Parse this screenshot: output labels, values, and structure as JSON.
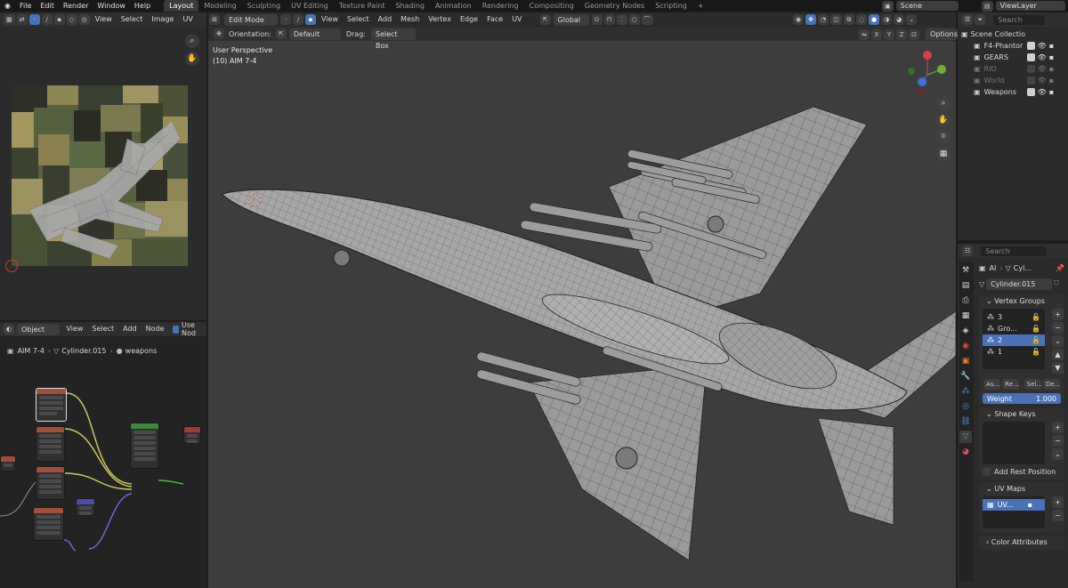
{
  "topbar": {
    "menus": [
      "File",
      "Edit",
      "Render",
      "Window",
      "Help"
    ],
    "workspaces": [
      "Layout",
      "Modeling",
      "Sculpting",
      "UV Editing",
      "Texture Paint",
      "Shading",
      "Animation",
      "Rendering",
      "Compositing",
      "Geometry Nodes",
      "Scripting"
    ],
    "add_tab": "+",
    "scene": "Scene",
    "view_layer": "ViewLayer"
  },
  "uv_editor": {
    "menus": [
      "View",
      "Select",
      "Image",
      "UV"
    ]
  },
  "node_editor": {
    "mode": "Object",
    "menus": [
      "View",
      "Select",
      "Add",
      "Node"
    ],
    "use_nodes": "Use Nod",
    "breadcrumb": [
      "AIM 7-4",
      "Cylinder.015",
      "weapons"
    ]
  },
  "viewport": {
    "mode": "Edit Mode",
    "menus": [
      "View",
      "Select",
      "Add",
      "Mesh",
      "Vertex",
      "Edge",
      "Face",
      "UV"
    ],
    "transform": "Global",
    "orientation_label": "Orientation:",
    "orientation_value": "Default",
    "drag_label": "Drag:",
    "drag_value": "Select Box",
    "axes": [
      "X",
      "Y",
      "Z"
    ],
    "options": "Options",
    "overlay_title": "User Perspective",
    "overlay_object": "(10) AIM 7-4"
  },
  "outliner": {
    "search_placeholder": "Search",
    "root": "Scene Collectio",
    "items": [
      {
        "name": "F4-Phantor",
        "dim": false
      },
      {
        "name": "GEARS",
        "dim": false
      },
      {
        "name": "RIO",
        "dim": true
      },
      {
        "name": "World",
        "dim": true
      },
      {
        "name": "Weapons",
        "dim": false
      }
    ]
  },
  "properties": {
    "search_placeholder": "Search",
    "breadcrumb": [
      "AI",
      "Cyl..."
    ],
    "mesh_name": "Cylinder.015",
    "vertex_groups": {
      "title": "Vertex Groups",
      "items": [
        "3",
        "Gro...",
        "2",
        "1"
      ],
      "selected_index": 2,
      "buttons": [
        "As...",
        "Re...",
        "Sel...",
        "De..."
      ],
      "weight_label": "Weight",
      "weight_value": "1.000"
    },
    "shape_keys": {
      "title": "Shape Keys",
      "add_rest": "Add Rest Position"
    },
    "uv_maps": {
      "title": "UV Maps",
      "item": "UV..."
    },
    "color_attributes": {
      "title": "Color Attributes"
    }
  },
  "colors": {
    "accent": "#4a72b8",
    "viewport_bg": "#3d3d3d",
    "panel_bg": "#2b2b2b"
  }
}
